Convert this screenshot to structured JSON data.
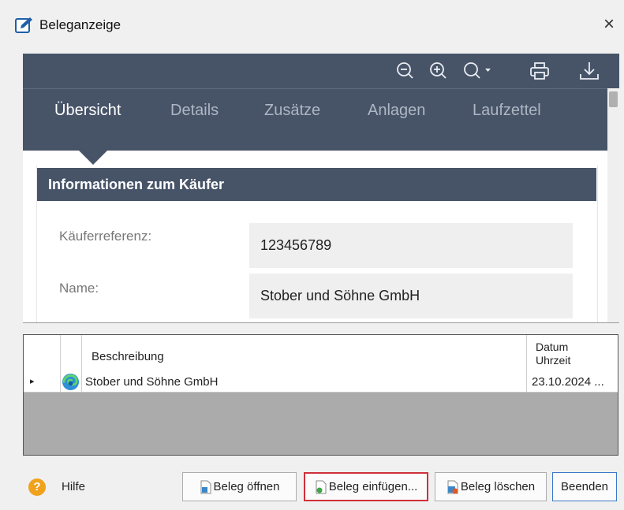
{
  "window": {
    "title": "Beleganzeige",
    "close_symbol": "×"
  },
  "toolbar": {
    "icons": [
      "zoom-out-icon",
      "zoom-in-icon",
      "zoom-menu-icon",
      "print-icon",
      "download-icon"
    ]
  },
  "tabs": [
    {
      "label": "Übersicht",
      "active": true
    },
    {
      "label": "Details",
      "active": false
    },
    {
      "label": "Zusätze",
      "active": false
    },
    {
      "label": "Anlagen",
      "active": false
    },
    {
      "label": "Laufzettel",
      "active": false
    }
  ],
  "section": {
    "title": "Informationen zum Käufer"
  },
  "fields": [
    {
      "label": "Käuferreferenz:",
      "value": "123456789"
    },
    {
      "label": "Name:",
      "value": "Stober und Söhne GmbH"
    }
  ],
  "grid": {
    "columns": {
      "description": "Beschreibung",
      "date_line1": "Datum",
      "date_line2": "Uhrzeit"
    },
    "rows": [
      {
        "indicator": "▸",
        "description": "Stober und Söhne GmbH",
        "date": "23.10.2024 ..."
      }
    ]
  },
  "footer": {
    "help_symbol": "?",
    "help_label": "Hilfe",
    "buttons": {
      "open": "Beleg öffnen",
      "insert": "Beleg einfügen...",
      "delete": "Beleg löschen",
      "exit": "Beenden"
    }
  },
  "colors": {
    "header_bg": "#475468",
    "highlight_border": "#d0303a",
    "exit_border": "#3a78c8",
    "help_icon": "#f0a21c"
  }
}
